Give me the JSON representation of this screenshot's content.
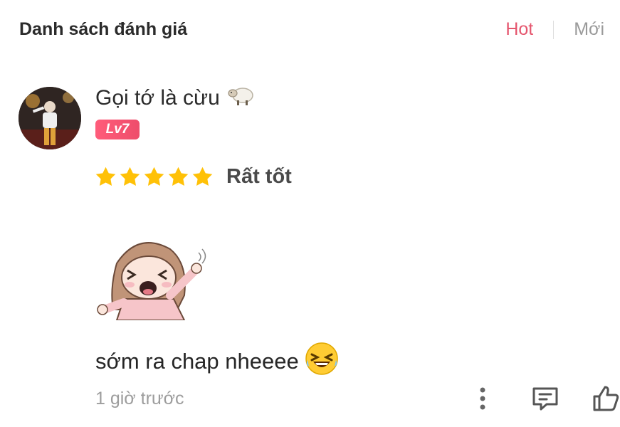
{
  "header": {
    "title": "Danh sách đánh giá",
    "tabs": [
      {
        "label": "Hot",
        "active": true
      },
      {
        "label": "Mới",
        "active": false
      }
    ],
    "accent_color": "#e5566e"
  },
  "review": {
    "user": {
      "name": "Gọi tớ là cừu",
      "name_emoji": "sheep-icon",
      "level": "Lv7"
    },
    "rating": {
      "stars": 5,
      "max": 5,
      "label": "Rất tốt",
      "star_color": "#ffc107"
    },
    "sticker": "laughing-girl-sticker",
    "comment": "sớm ra chap nheeee",
    "comment_emoji": "laughing-face-icon",
    "timestamp": "1 giờ trước",
    "actions": [
      "more-icon",
      "reply-icon",
      "like-icon"
    ]
  }
}
